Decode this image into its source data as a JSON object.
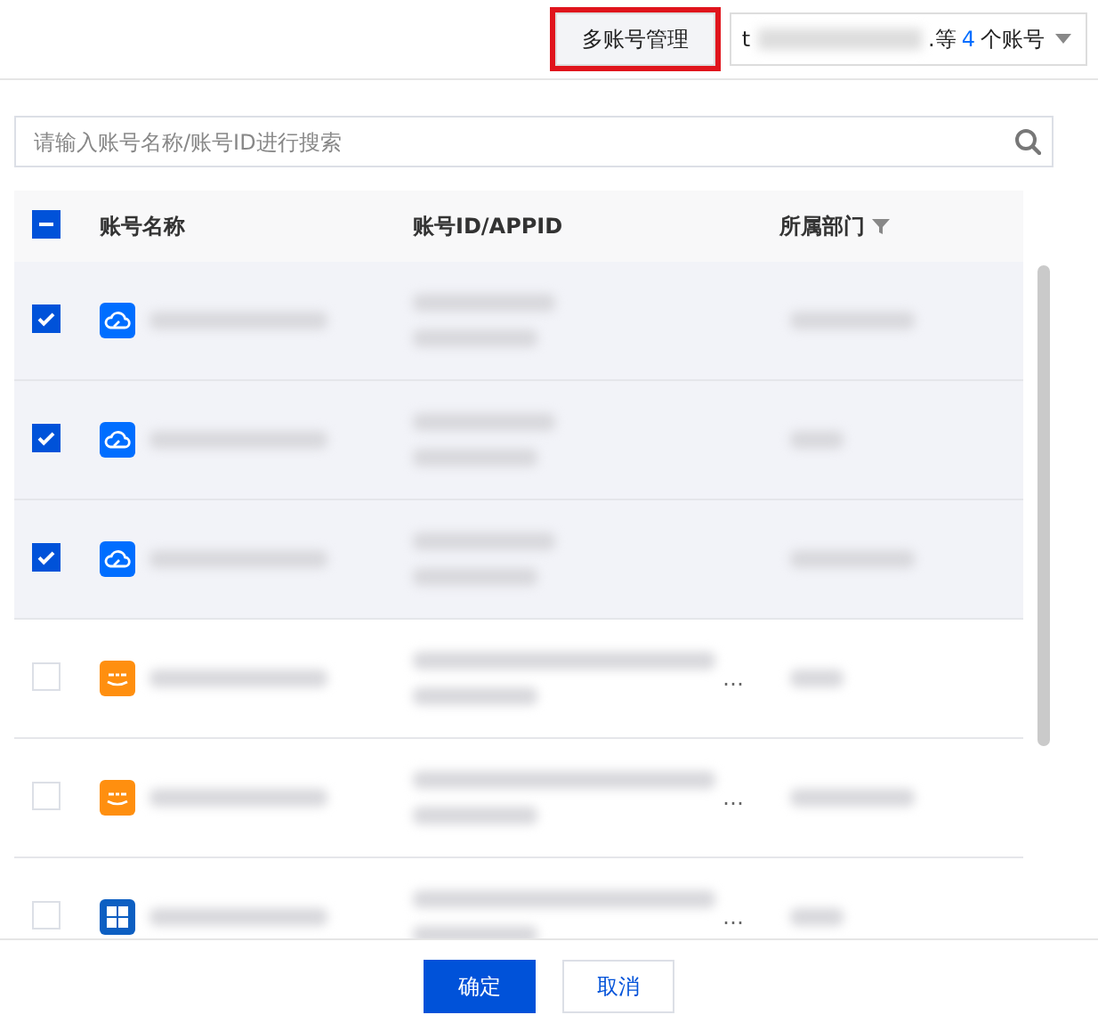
{
  "top_bar": {
    "manage_button": {
      "label": "多账号管理",
      "highlighted": true
    },
    "account_picker": {
      "lead": "t",
      "tail": ".等",
      "count": "4",
      "unit": "个账号"
    }
  },
  "search": {
    "placeholder": "请输入账号名称/账号ID进行搜索"
  },
  "table": {
    "header_indeterminate": true,
    "columns": [
      "账号名称",
      "账号ID/APPID",
      "所属部门"
    ],
    "rows": [
      {
        "kind": "cloud",
        "selected": true
      },
      {
        "kind": "cloud",
        "selected": true
      },
      {
        "kind": "cloud",
        "selected": true
      },
      {
        "kind": "smile",
        "selected": false,
        "id_tail": "…"
      },
      {
        "kind": "smile",
        "selected": false,
        "id_tail": "…"
      },
      {
        "kind": "grid",
        "selected": false,
        "id_tail": "…"
      }
    ]
  },
  "footer": {
    "buttons": [
      {
        "label": "确定",
        "kind": "primary"
      },
      {
        "label": "取消",
        "kind": "secondary"
      }
    ]
  }
}
